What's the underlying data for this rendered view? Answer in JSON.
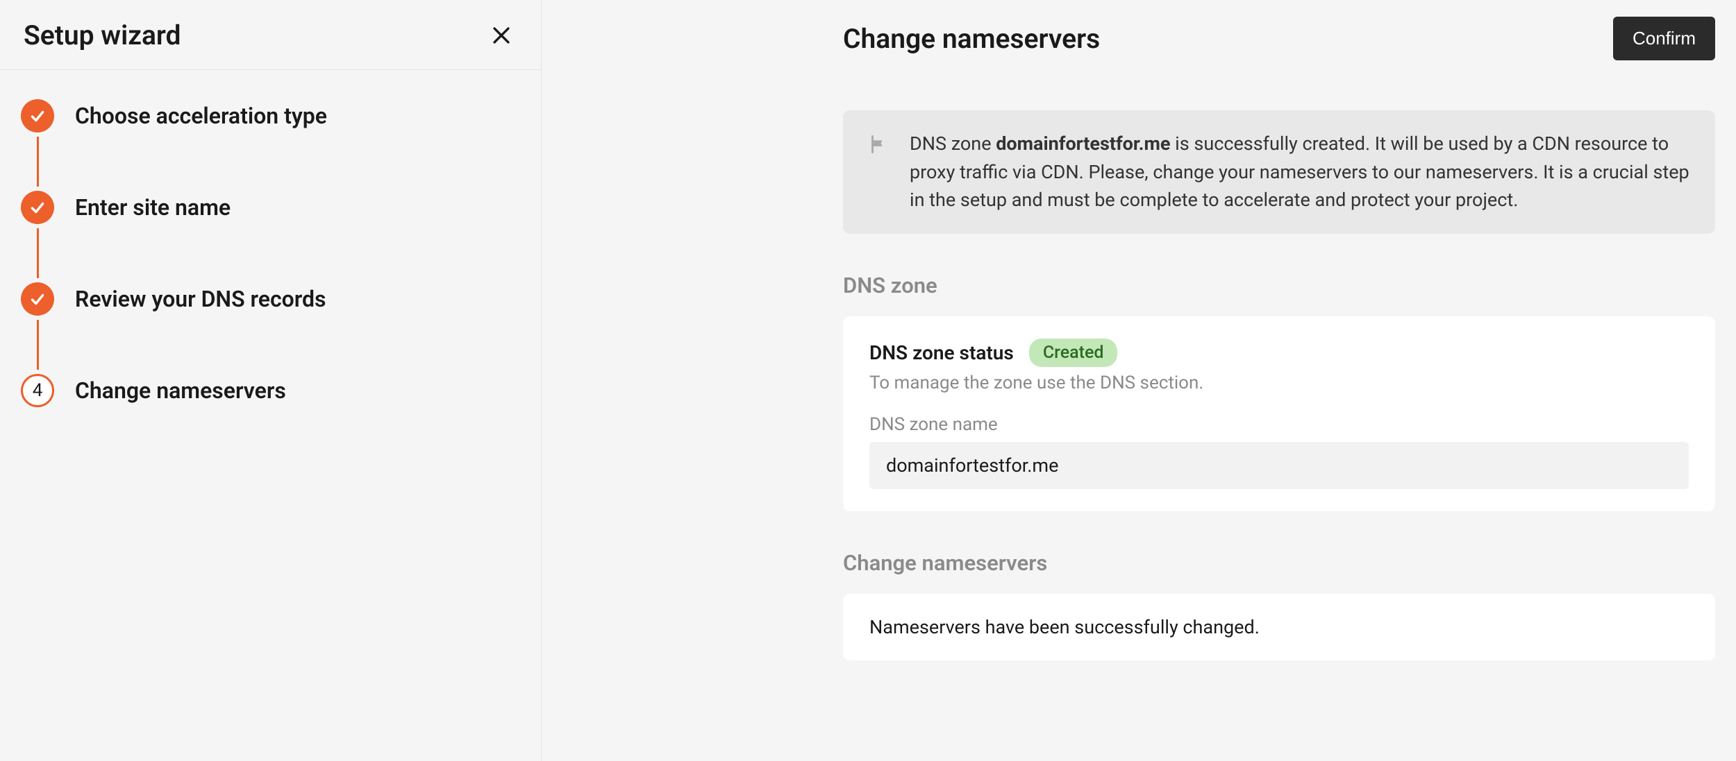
{
  "sidebar": {
    "title": "Setup wizard",
    "steps": [
      {
        "label": "Choose acceleration type",
        "state": "done"
      },
      {
        "label": "Enter site name",
        "state": "done"
      },
      {
        "label": "Review your DNS records",
        "state": "done"
      },
      {
        "label": "Change nameservers",
        "state": "current",
        "number": "4"
      }
    ]
  },
  "main": {
    "title": "Change nameservers",
    "confirm_label": "Confirm",
    "banner": {
      "prefix": "DNS zone ",
      "domain_bold": "domainfortestfor.me",
      "suffix": " is successfully created. It will be used by a CDN resource to proxy traffic via CDN. Please, change your nameservers to our nameservers. It is a crucial step in the setup and must be complete to accelerate and protect your project."
    },
    "dns_zone": {
      "section_title": "DNS zone",
      "status_label": "DNS zone status",
      "status_badge": "Created",
      "status_sub": "To manage the zone use the DNS section.",
      "name_label": "DNS zone name",
      "name_value": "domainfortestfor.me"
    },
    "change_ns": {
      "section_title": "Change nameservers",
      "message": "Nameservers have been successfully changed."
    }
  }
}
